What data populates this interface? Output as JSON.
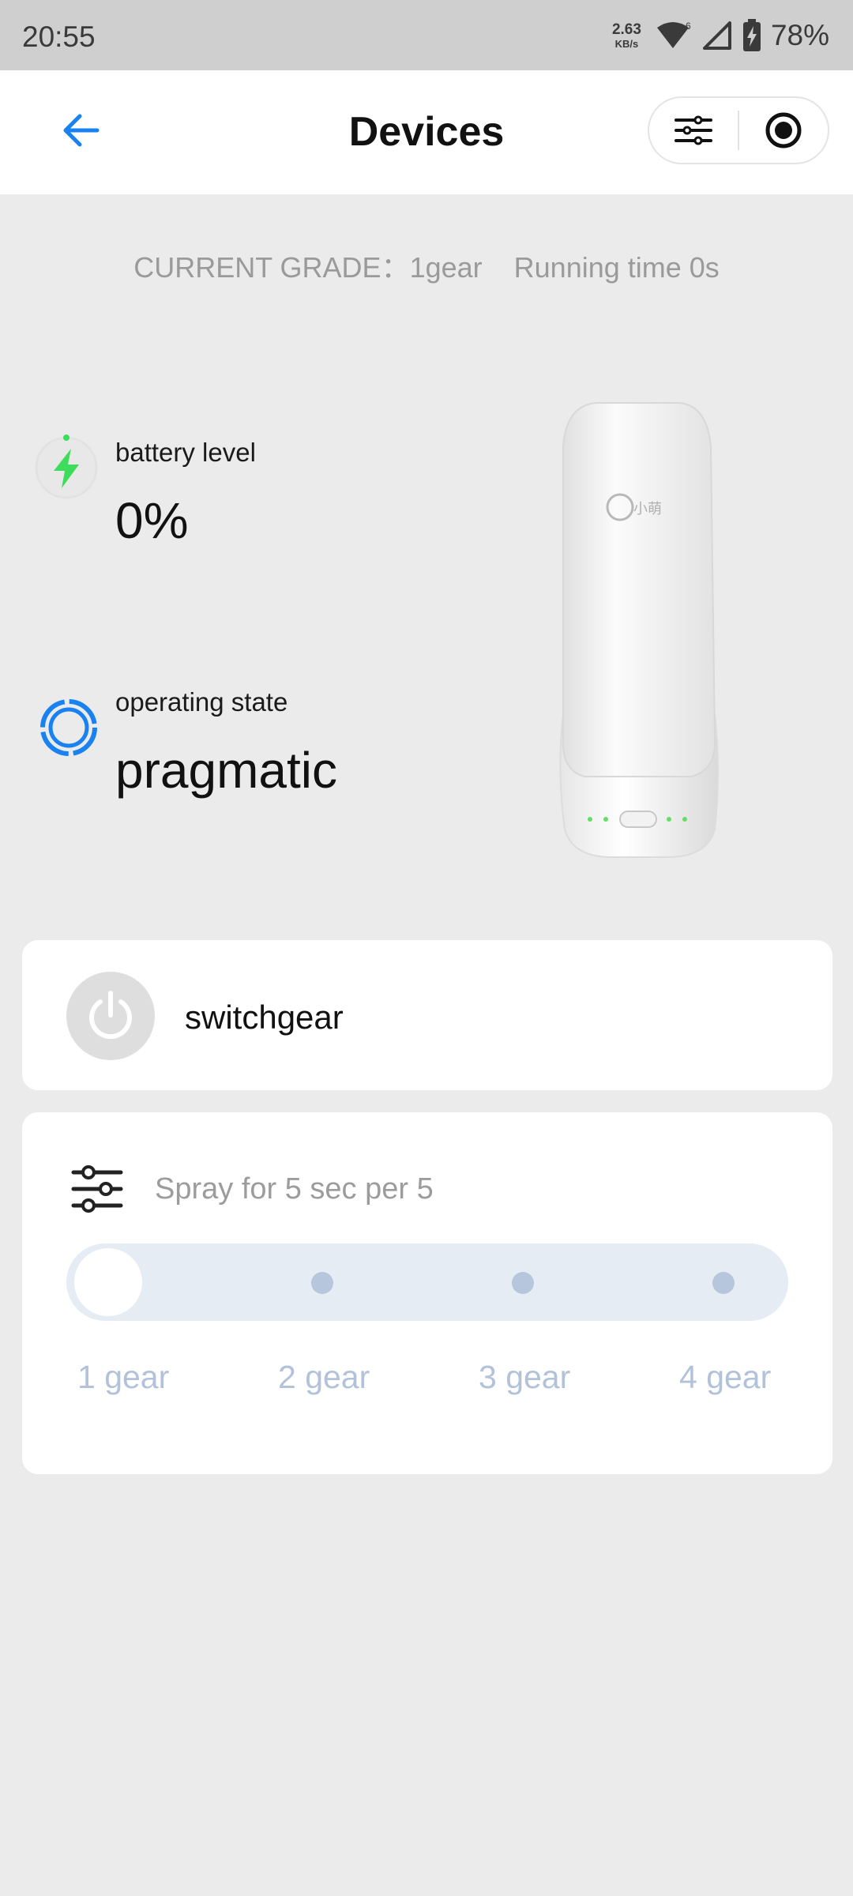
{
  "status_bar": {
    "time": "20:55",
    "net_speed_value": "2.63",
    "net_speed_unit": "KB/s",
    "wifi_badge": "6",
    "battery_percent": "78%"
  },
  "header": {
    "title": "Devices",
    "back_icon": "arrow-left-icon",
    "settings_icon": "sliders-icon",
    "record_icon": "record-circle-icon"
  },
  "grade": {
    "text": "CURRENT GRADE：1gear    Running time 0s"
  },
  "battery": {
    "label": "battery level",
    "value": "0%",
    "icon": "lightning-icon",
    "icon_color": "#3ddc5b"
  },
  "state": {
    "label": "operating state",
    "value": "pragmatic",
    "icon": "ring-icon",
    "icon_color": "#1a82f0"
  },
  "device_image": {
    "logo_text": "小萌"
  },
  "switch": {
    "label": "switchgear",
    "icon": "power-icon"
  },
  "gear_panel": {
    "spray_text": "Spray for 5 sec per 5",
    "selected_index": 0,
    "gears": [
      {
        "label": "1 gear"
      },
      {
        "label": "2 gear"
      },
      {
        "label": "3 gear"
      },
      {
        "label": "4 gear"
      }
    ]
  },
  "colors": {
    "accent_blue": "#1a82f0",
    "battery_green": "#3ddc5b",
    "gear_label": "#b2c2d8"
  }
}
